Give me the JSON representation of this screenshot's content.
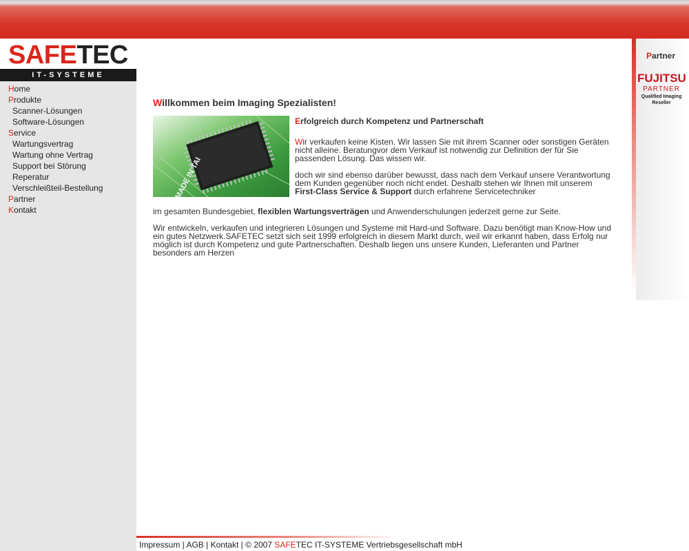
{
  "logo": {
    "part1": "SAFE",
    "part2": "TEC",
    "subtitle": "IT-SYSTEME"
  },
  "nav": [
    {
      "first": "H",
      "rest": "ome",
      "level": "top"
    },
    {
      "first": "P",
      "rest": "rodukte",
      "level": "top"
    },
    {
      "label": "Scanner-Lösungen",
      "level": "sub"
    },
    {
      "label": "Software-Lösungen",
      "level": "sub"
    },
    {
      "first": "S",
      "rest": "ervice",
      "level": "top"
    },
    {
      "label": "Wartungsvertrag",
      "level": "sub"
    },
    {
      "label": "Wartung ohne Vertrag",
      "level": "sub"
    },
    {
      "label": "Support bei Störung",
      "level": "sub"
    },
    {
      "label": "Reperatur",
      "level": "sub"
    },
    {
      "label": "Verschleißteil-Bestellung",
      "level": "sub"
    },
    {
      "first": "P",
      "rest": "artner",
      "level": "top"
    },
    {
      "first": "K",
      "rest": "ontakt",
      "level": "top"
    }
  ],
  "main": {
    "heading_first": "W",
    "heading_rest": "illkommen beim Imaging Spezialisten!",
    "subheading_first": "E",
    "subheading_rest": "rfolgreich durch Kompetenz und Partnerschaft",
    "p1_first": "W",
    "p1_rest": "ir verkaufen keine Kisten. Wir lassen Sie mit ihrem Scanner oder sonstigen Geräten nicht alleine. Beratungvor dem Verkauf ist notwendig zur Definition der für Sie passenden Lösung. Das wissen wir.",
    "p2_a": "doch wir sind ebenso darüber bewusst, dass nach dem Verkauf unsere Verantwortung dem Kunden gegenüber noch nicht endet. Deshalb stehen wir Ihnen mit unserem",
    "p2_bold": "First-Class Service & Support",
    "p2_b": "durch erfahrene Servicetechniker",
    "p3_a": "im gesamten Bundesgebiet,",
    "p3_bold": "flexiblen Wartungsverträgen",
    "p3_b": "und Anwenderschulungen jederzeit gerne zur Seite.",
    "p4": "Wir entwickeln, verkaufen und integrieren Lösungen und Systeme mit Hard-und Software. Dazu benötigt man Know-How und ein gutes Netzwerk.SAFETEC setzt sich seit 1999 erfolgreich in diesem Markt durch, weil wir erkannt haben, dass Erfolg nur möglich ist durch Kompetenz und gute Partnerschaften. Deshalb liegen uns unsere Kunden, Lieferanten und Partner besonders am Herzen",
    "chip_label": "MADE IN TAI"
  },
  "partner": {
    "title_first": "P",
    "title_rest": "artner",
    "fujitsu_brand": "FUJITSU",
    "fujitsu_partner": "PARTNER",
    "fujitsu_q1": "Qualified Imaging",
    "fujitsu_q2": "Reseller"
  },
  "footer": {
    "impressum": "Impressum",
    "agb": "AGB",
    "kontakt": "Kontakt",
    "sep": " | ",
    "copy": "© 2007 ",
    "name_red": "SAFE",
    "name_rest": "TEC IT-SYSTEME Vertriebsgesellschaft mbH"
  }
}
